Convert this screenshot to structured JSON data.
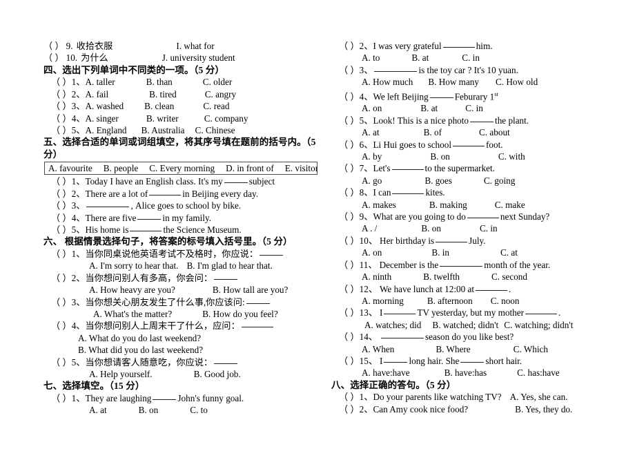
{
  "document": {
    "type": "english-exam-paper",
    "page_background": "#ffffff",
    "text_color": "#000000"
  },
  "left_column": {
    "matching_tail": {
      "items": [
        {
          "paren": "（   ）",
          "num": "9.",
          "cn": "收拾衣服",
          "answer": "I. what for"
        },
        {
          "paren": "（   ）",
          "num": "10.",
          "cn": "为什么",
          "answer": "J. university student"
        }
      ]
    },
    "section4": {
      "heading": "四、选出下列单词中不同类的一项。（5 分）",
      "items": [
        {
          "paren": "（   ）",
          "num": "1、",
          "a": "A. taller",
          "b": "B. than",
          "c": "C. older"
        },
        {
          "paren": "（   ）",
          "num": "2、",
          "a": "A. fail",
          "b": "B. tired",
          "c": "C. angry"
        },
        {
          "paren": "（   ）",
          "num": "3、",
          "a": "A. washed",
          "b": "B. clean",
          "c": "C. read"
        },
        {
          "paren": "（   ）",
          "num": "4、",
          "a": "A. singer",
          "b": "B. writer",
          "c": "C. company"
        },
        {
          "paren": "（   ）",
          "num": "5、",
          "a": "A. England",
          "b": "B. Australia",
          "c": "C. Chinese"
        }
      ]
    },
    "section5": {
      "heading_line1": "五、选择合适的单词或词组填空，将其序号填在题前的括号内。（5",
      "heading_line2": "分）",
      "wordbank": [
        "A. favourite",
        "B. people",
        "C. Every morning",
        "D. in front of",
        "E. visitors"
      ],
      "items": [
        {
          "paren": "（   ）",
          "num": "1、",
          "before": "Today I have an English class. It's my",
          "after": "subject"
        },
        {
          "paren": "（   ）",
          "num": "2、",
          "before": "There are a lot of",
          "after": "in Beijing every day."
        },
        {
          "paren": "（   ）",
          "num": "3、",
          "before": "",
          "after": ", Alice goes to school by bike."
        },
        {
          "paren": "（   ）",
          "num": "4、",
          "before": "There are five",
          "after": "in my family."
        },
        {
          "paren": "（   ）",
          "num": "5、",
          "before": "His home is",
          "after": "the Science Museum."
        }
      ]
    },
    "section6": {
      "heading": "六、  根据情景选择句子，将答案的标号填入括号里。（5 分）",
      "items": [
        {
          "paren": "（   ）",
          "num": "1、",
          "stem": "当你同桌说他英语考试不及格时，你应说：",
          "a": "A. I'm sorry to hear that.",
          "b": "B. I'm glad to hear that.",
          "layout": "inline"
        },
        {
          "paren": "（   ）",
          "num": "2、",
          "stem": "当你想问别人有多高，你会问：",
          "a": "A. How heavy are you?",
          "b": "B. How tall are you?",
          "layout": "inline"
        },
        {
          "paren": "（   ）",
          "num": "3、",
          "stem": "当你想关心朋友发生了什么事,你应该问:",
          "a": "A. What's the matter?",
          "b": "B. How do you feel?",
          "layout": "inline"
        },
        {
          "paren": "（   ）",
          "num": "4、",
          "stem": "当你想问别人上周末干了什么，应问：",
          "a": "A. What do you do last weekend?",
          "b": "B. What did you do last weekend?",
          "layout": "stacked"
        },
        {
          "paren": "（   ）",
          "num": "5、",
          "stem": "当你想请客人随意吃，你应说：",
          "a": "A. Help yourself.",
          "b": "B. Good job.",
          "layout": "inline"
        }
      ]
    },
    "section7": {
      "heading": "七、选择填空。（15 分）",
      "items": [
        {
          "paren": "（   ）",
          "num": "1、",
          "before": "They are laughing",
          "after": "John's funny goal.",
          "a": "A. at",
          "b": "B. on",
          "c": "C. to"
        }
      ]
    }
  },
  "right_column": {
    "section7_continued": {
      "items": [
        {
          "paren": "（   ）",
          "num": "2、",
          "before": "I was very grateful",
          "after": "him.",
          "blank": "l",
          "a": "A. to",
          "b": "B. at",
          "c": "C. in"
        },
        {
          "paren": "（   ）",
          "num": "3、",
          "before": "",
          "after": "is the toy car ?          It's 10 yuan.",
          "blank": "xl",
          "a": "A. How much",
          "b": "B. How many",
          "c": "C. How old"
        },
        {
          "paren": "（   ）",
          "num": "4、",
          "before": "We left Beijing",
          "after": "Feburary 1",
          "sup": "st",
          "blank": "m",
          "a": "A. on",
          "b": "B. at",
          "c": "C. in"
        },
        {
          "paren": "（   ）",
          "num": "5、",
          "before": "Look! This is a nice photo",
          "after": "the plant.",
          "blank": "m",
          "a": "A. at",
          "b": "B. of",
          "c": "C. about"
        },
        {
          "paren": "（   ）",
          "num": "6、",
          "before": "Li Hui goes to school",
          "after": "foot.",
          "blank": "l",
          "a": "A. by",
          "b": "B. on",
          "c": "C. with"
        },
        {
          "paren": "（   ）",
          "num": "7、",
          "before": "Let's",
          "after": "to the supermarket.",
          "blank": "l",
          "a": "A. go",
          "b": "B. goes",
          "c": "C. going"
        },
        {
          "paren": "（   ）",
          "num": "8、",
          "before": "I can",
          "after": "kites.",
          "blank": "l",
          "a": "A. makes",
          "b": "B. making",
          "c": "C. make"
        },
        {
          "paren": "（   ）",
          "num": "9、",
          "before": "What are you going to do",
          "after": "next Sunday?",
          "blank": "l",
          "a": "A . /",
          "b": "B. on",
          "c": "C. in"
        },
        {
          "paren": "（   ）",
          "num": "10、",
          "before": "Her birthday is",
          "after": "July.",
          "blank": "l",
          "a": "A. on",
          "b": "B. in",
          "c": "C. at"
        },
        {
          "paren": "（   ）",
          "num": "11、",
          "before": "December is the",
          "after": "month of the year.",
          "blank": "xl",
          "a": "A. ninth",
          "b": "B. twelfth",
          "c": "C. second"
        },
        {
          "paren": "（   ）",
          "num": "12、",
          "before": "We have lunch at 12:00 at",
          "after": ".",
          "blank": "l",
          "a": "A. morning",
          "b": "B. afternoon",
          "c": "C. noon"
        },
        {
          "paren": "（   ）",
          "num": "13、",
          "before": "I",
          "after": "TV yesterday, but my mother",
          "blank": "l",
          "blank2": "l",
          "tail": ".",
          "a": "A. watches; did",
          "b": "B. watched; didn't",
          "c": "C. watching; didn't"
        },
        {
          "paren": "（   ）",
          "num": "14、",
          "before": "",
          "after": "season do you like best?",
          "blank": "xl",
          "a": "A. When",
          "b": "B. Where",
          "c": "C. Which"
        },
        {
          "paren": "（   ）",
          "num": "15、",
          "before": "I",
          "after": "long hair. She",
          "blank": "m",
          "blank2": "m",
          "tail": "short hair.",
          "a": "A. have:have",
          "b": "B. have:has",
          "c": "C. has:have"
        }
      ]
    },
    "section8": {
      "heading": "八、选择正确的答句。（5 分）",
      "items": [
        {
          "paren": "（   ）",
          "num": "1、",
          "question": "Do your parents like watching TV?",
          "answer": "A. Yes, she can."
        },
        {
          "paren": "（   ）",
          "num": "2、",
          "question": "Can Amy cook nice food?",
          "answer": "B. Yes, they do."
        }
      ]
    }
  }
}
